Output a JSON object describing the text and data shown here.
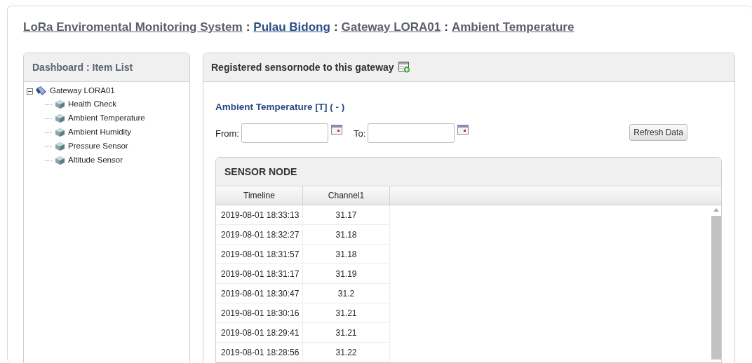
{
  "breadcrumb": [
    {
      "label": "LoRa Enviromental Monitoring System",
      "visited": true
    },
    {
      "label": "Pulau Bidong",
      "visited": false
    },
    {
      "label": "Gateway LORA01",
      "visited": true
    },
    {
      "label": "Ambient Temperature",
      "visited": true
    }
  ],
  "breadcrumb_separators": [
    ":",
    ":",
    ":"
  ],
  "sidebar": {
    "title": "Dashboard : Item List",
    "tree": [
      {
        "label": "Gateway LORA01",
        "expanded": true,
        "children": [
          {
            "label": "Health Check"
          },
          {
            "label": "Ambient Temperature"
          },
          {
            "label": "Ambient Humidity"
          },
          {
            "label": "Pressure Sensor"
          },
          {
            "label": "Altitude Sensor"
          }
        ]
      }
    ]
  },
  "main": {
    "title": "Registered sensornode to this gateway",
    "section_title": "Ambient Temperature [T] ( - )",
    "from": {
      "label": "From:"
    },
    "to": {
      "label": "To:"
    },
    "refresh_button": "Refresh Data",
    "table": {
      "title": "SENSOR NODE",
      "columns": [
        "Timeline",
        "Channel1"
      ],
      "rows": [
        [
          "2019-08-01 18:33:13",
          "31.17"
        ],
        [
          "2019-08-01 18:32:27",
          "31.18"
        ],
        [
          "2019-08-01 18:31:57",
          "31.18"
        ],
        [
          "2019-08-01 18:31:17",
          "31.19"
        ],
        [
          "2019-08-01 18:30:47",
          "31.2"
        ],
        [
          "2019-08-01 18:30:16",
          "31.21"
        ],
        [
          "2019-08-01 18:29:41",
          "31.21"
        ],
        [
          "2019-08-01 18:28:56",
          "31.22"
        ]
      ]
    }
  }
}
